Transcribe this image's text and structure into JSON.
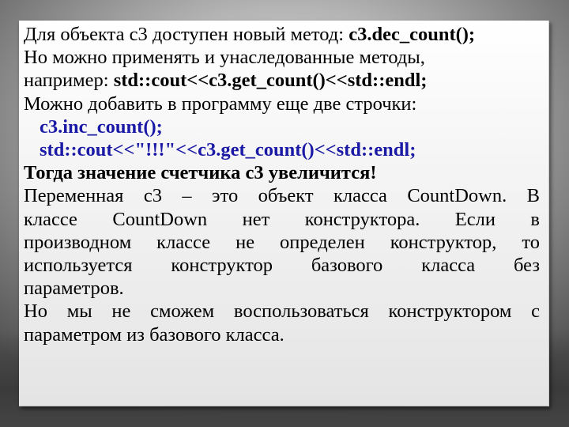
{
  "slide": {
    "line1": {
      "text": "Для объекта с3 доступен новый метод: ",
      "code": "c3.dec_count();"
    },
    "line2": {
      "text": "Но можно применять и унаследованные методы,"
    },
    "line3": {
      "text": "например: ",
      "code": "std::cout<<c3.get_count()<<std::endl;"
    },
    "line4": {
      "text": "Можно добавить в программу еще две строчки:"
    },
    "code_lines": [
      "c3.inc_count();",
      "std::cout<<\"!!!\"<<c3.get_count()<<std::endl;"
    ],
    "bold_statement": "Тогда значение счетчика с3 увеличится!",
    "paragraph1_lines": [
      "Переменная с3 – это объект класса CountDown. В",
      "классе CountDown нет конструктора. Если в",
      "производном классе не определен конструктор, то",
      "используется конструктор базового класса без",
      "параметров."
    ],
    "paragraph2_lines": [
      "Но мы не сможем воспользоваться конструктором с",
      "параметром из базового класса."
    ]
  },
  "colors": {
    "code_text": "#1a1aa6",
    "body_text": "#000000"
  }
}
